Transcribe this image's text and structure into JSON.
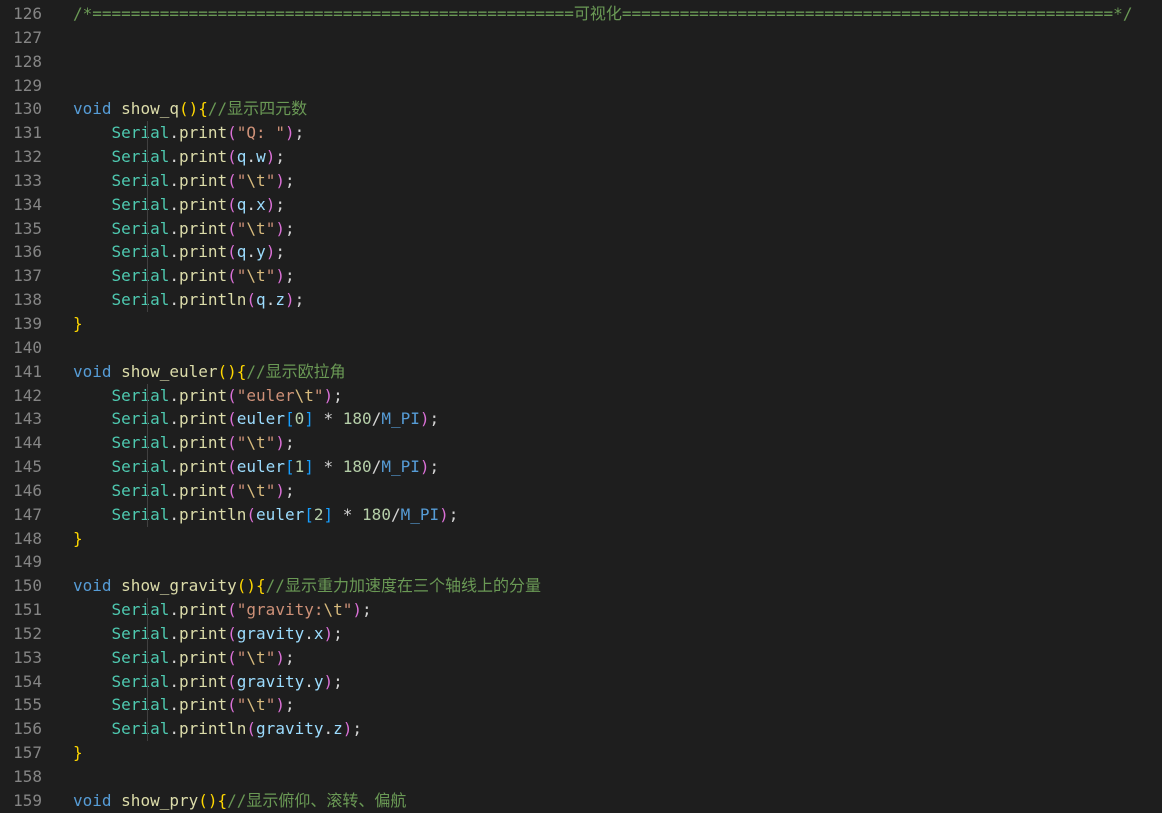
{
  "editor": {
    "language": "cpp",
    "colors": {
      "background": "#1e1e1e",
      "line_number": "#858585",
      "keyword": "#569cd6",
      "function": "#dcdcaa",
      "class": "#4ec9b0",
      "variable": "#9cdcfe",
      "string": "#ce9178",
      "escape": "#d7ba7d",
      "number": "#b5cea8",
      "comment": "#6a9955",
      "bracket_level_1": "#ffd700",
      "bracket_level_2": "#da70d6",
      "bracket_level_3": "#179fff"
    },
    "lines": [
      {
        "num": "126",
        "tokens": [
          [
            "cmt",
            "/*==================================================可视化===================================================*/"
          ]
        ]
      },
      {
        "num": "127",
        "tokens": []
      },
      {
        "num": "128",
        "tokens": []
      },
      {
        "num": "129",
        "tokens": []
      },
      {
        "num": "130",
        "tokens": [
          [
            "kw",
            "void"
          ],
          [
            "op",
            " "
          ],
          [
            "fn",
            "show_q"
          ],
          [
            "b1",
            "()"
          ],
          [
            "b1",
            "{"
          ],
          [
            "cmt",
            "//显示四元数"
          ]
        ]
      },
      {
        "num": "131",
        "guide": true,
        "tokens": [
          [
            "op",
            "    "
          ],
          [
            "obj",
            "Serial"
          ],
          [
            "op",
            "."
          ],
          [
            "fn",
            "print"
          ],
          [
            "b2",
            "("
          ],
          [
            "str",
            "\"Q: \""
          ],
          [
            "b2",
            ")"
          ],
          [
            "op",
            ";"
          ]
        ]
      },
      {
        "num": "132",
        "guide": true,
        "tokens": [
          [
            "op",
            "    "
          ],
          [
            "obj",
            "Serial"
          ],
          [
            "op",
            "."
          ],
          [
            "fn",
            "print"
          ],
          [
            "b2",
            "("
          ],
          [
            "var",
            "q"
          ],
          [
            "op",
            "."
          ],
          [
            "var",
            "w"
          ],
          [
            "b2",
            ")"
          ],
          [
            "op",
            ";"
          ]
        ]
      },
      {
        "num": "133",
        "guide": true,
        "tokens": [
          [
            "op",
            "    "
          ],
          [
            "obj",
            "Serial"
          ],
          [
            "op",
            "."
          ],
          [
            "fn",
            "print"
          ],
          [
            "b2",
            "("
          ],
          [
            "str",
            "\""
          ],
          [
            "esc",
            "\\t"
          ],
          [
            "str",
            "\""
          ],
          [
            "b2",
            ")"
          ],
          [
            "op",
            ";"
          ]
        ]
      },
      {
        "num": "134",
        "guide": true,
        "tokens": [
          [
            "op",
            "    "
          ],
          [
            "obj",
            "Serial"
          ],
          [
            "op",
            "."
          ],
          [
            "fn",
            "print"
          ],
          [
            "b2",
            "("
          ],
          [
            "var",
            "q"
          ],
          [
            "op",
            "."
          ],
          [
            "var",
            "x"
          ],
          [
            "b2",
            ")"
          ],
          [
            "op",
            ";"
          ]
        ]
      },
      {
        "num": "135",
        "guide": true,
        "tokens": [
          [
            "op",
            "    "
          ],
          [
            "obj",
            "Serial"
          ],
          [
            "op",
            "."
          ],
          [
            "fn",
            "print"
          ],
          [
            "b2",
            "("
          ],
          [
            "str",
            "\""
          ],
          [
            "esc",
            "\\t"
          ],
          [
            "str",
            "\""
          ],
          [
            "b2",
            ")"
          ],
          [
            "op",
            ";"
          ]
        ]
      },
      {
        "num": "136",
        "guide": true,
        "tokens": [
          [
            "op",
            "    "
          ],
          [
            "obj",
            "Serial"
          ],
          [
            "op",
            "."
          ],
          [
            "fn",
            "print"
          ],
          [
            "b2",
            "("
          ],
          [
            "var",
            "q"
          ],
          [
            "op",
            "."
          ],
          [
            "var",
            "y"
          ],
          [
            "b2",
            ")"
          ],
          [
            "op",
            ";"
          ]
        ]
      },
      {
        "num": "137",
        "guide": true,
        "tokens": [
          [
            "op",
            "    "
          ],
          [
            "obj",
            "Serial"
          ],
          [
            "op",
            "."
          ],
          [
            "fn",
            "print"
          ],
          [
            "b2",
            "("
          ],
          [
            "str",
            "\""
          ],
          [
            "esc",
            "\\t"
          ],
          [
            "str",
            "\""
          ],
          [
            "b2",
            ")"
          ],
          [
            "op",
            ";"
          ]
        ]
      },
      {
        "num": "138",
        "guide": true,
        "tokens": [
          [
            "op",
            "    "
          ],
          [
            "obj",
            "Serial"
          ],
          [
            "op",
            "."
          ],
          [
            "fn",
            "println"
          ],
          [
            "b2",
            "("
          ],
          [
            "var",
            "q"
          ],
          [
            "op",
            "."
          ],
          [
            "var",
            "z"
          ],
          [
            "b2",
            ")"
          ],
          [
            "op",
            ";"
          ]
        ]
      },
      {
        "num": "139",
        "tokens": [
          [
            "b1",
            "}"
          ]
        ]
      },
      {
        "num": "140",
        "tokens": []
      },
      {
        "num": "141",
        "tokens": [
          [
            "kw",
            "void"
          ],
          [
            "op",
            " "
          ],
          [
            "fn",
            "show_euler"
          ],
          [
            "b1",
            "()"
          ],
          [
            "b1",
            "{"
          ],
          [
            "cmt",
            "//显示欧拉角"
          ]
        ]
      },
      {
        "num": "142",
        "guide": true,
        "tokens": [
          [
            "op",
            "    "
          ],
          [
            "obj",
            "Serial"
          ],
          [
            "op",
            "."
          ],
          [
            "fn",
            "print"
          ],
          [
            "b2",
            "("
          ],
          [
            "str",
            "\"euler"
          ],
          [
            "esc",
            "\\t"
          ],
          [
            "str",
            "\""
          ],
          [
            "b2",
            ")"
          ],
          [
            "op",
            ";"
          ]
        ]
      },
      {
        "num": "143",
        "guide": true,
        "tokens": [
          [
            "op",
            "    "
          ],
          [
            "obj",
            "Serial"
          ],
          [
            "op",
            "."
          ],
          [
            "fn",
            "print"
          ],
          [
            "b2",
            "("
          ],
          [
            "var",
            "euler"
          ],
          [
            "b3",
            "["
          ],
          [
            "num",
            "0"
          ],
          [
            "b3",
            "]"
          ],
          [
            "op",
            " * "
          ],
          [
            "num",
            "180"
          ],
          [
            "op",
            "/"
          ],
          [
            "mac",
            "M_PI"
          ],
          [
            "b2",
            ")"
          ],
          [
            "op",
            ";"
          ]
        ]
      },
      {
        "num": "144",
        "guide": true,
        "tokens": [
          [
            "op",
            "    "
          ],
          [
            "obj",
            "Serial"
          ],
          [
            "op",
            "."
          ],
          [
            "fn",
            "print"
          ],
          [
            "b2",
            "("
          ],
          [
            "str",
            "\""
          ],
          [
            "esc",
            "\\t"
          ],
          [
            "str",
            "\""
          ],
          [
            "b2",
            ")"
          ],
          [
            "op",
            ";"
          ]
        ]
      },
      {
        "num": "145",
        "guide": true,
        "tokens": [
          [
            "op",
            "    "
          ],
          [
            "obj",
            "Serial"
          ],
          [
            "op",
            "."
          ],
          [
            "fn",
            "print"
          ],
          [
            "b2",
            "("
          ],
          [
            "var",
            "euler"
          ],
          [
            "b3",
            "["
          ],
          [
            "num",
            "1"
          ],
          [
            "b3",
            "]"
          ],
          [
            "op",
            " * "
          ],
          [
            "num",
            "180"
          ],
          [
            "op",
            "/"
          ],
          [
            "mac",
            "M_PI"
          ],
          [
            "b2",
            ")"
          ],
          [
            "op",
            ";"
          ]
        ]
      },
      {
        "num": "146",
        "guide": true,
        "tokens": [
          [
            "op",
            "    "
          ],
          [
            "obj",
            "Serial"
          ],
          [
            "op",
            "."
          ],
          [
            "fn",
            "print"
          ],
          [
            "b2",
            "("
          ],
          [
            "str",
            "\""
          ],
          [
            "esc",
            "\\t"
          ],
          [
            "str",
            "\""
          ],
          [
            "b2",
            ")"
          ],
          [
            "op",
            ";"
          ]
        ]
      },
      {
        "num": "147",
        "guide": true,
        "tokens": [
          [
            "op",
            "    "
          ],
          [
            "obj",
            "Serial"
          ],
          [
            "op",
            "."
          ],
          [
            "fn",
            "println"
          ],
          [
            "b2",
            "("
          ],
          [
            "var",
            "euler"
          ],
          [
            "b3",
            "["
          ],
          [
            "num",
            "2"
          ],
          [
            "b3",
            "]"
          ],
          [
            "op",
            " * "
          ],
          [
            "num",
            "180"
          ],
          [
            "op",
            "/"
          ],
          [
            "mac",
            "M_PI"
          ],
          [
            "b2",
            ")"
          ],
          [
            "op",
            ";"
          ]
        ]
      },
      {
        "num": "148",
        "tokens": [
          [
            "b1",
            "}"
          ]
        ]
      },
      {
        "num": "149",
        "tokens": []
      },
      {
        "num": "150",
        "tokens": [
          [
            "kw",
            "void"
          ],
          [
            "op",
            " "
          ],
          [
            "fn",
            "show_gravity"
          ],
          [
            "b1",
            "()"
          ],
          [
            "b1",
            "{"
          ],
          [
            "cmt",
            "//显示重力加速度在三个轴线上的分量"
          ]
        ]
      },
      {
        "num": "151",
        "guide": true,
        "tokens": [
          [
            "op",
            "    "
          ],
          [
            "obj",
            "Serial"
          ],
          [
            "op",
            "."
          ],
          [
            "fn",
            "print"
          ],
          [
            "b2",
            "("
          ],
          [
            "str",
            "\"gravity:"
          ],
          [
            "esc",
            "\\t"
          ],
          [
            "str",
            "\""
          ],
          [
            "b2",
            ")"
          ],
          [
            "op",
            ";"
          ]
        ]
      },
      {
        "num": "152",
        "guide": true,
        "tokens": [
          [
            "op",
            "    "
          ],
          [
            "obj",
            "Serial"
          ],
          [
            "op",
            "."
          ],
          [
            "fn",
            "print"
          ],
          [
            "b2",
            "("
          ],
          [
            "var",
            "gravity"
          ],
          [
            "op",
            "."
          ],
          [
            "var",
            "x"
          ],
          [
            "b2",
            ")"
          ],
          [
            "op",
            ";"
          ]
        ]
      },
      {
        "num": "153",
        "guide": true,
        "tokens": [
          [
            "op",
            "    "
          ],
          [
            "obj",
            "Serial"
          ],
          [
            "op",
            "."
          ],
          [
            "fn",
            "print"
          ],
          [
            "b2",
            "("
          ],
          [
            "str",
            "\""
          ],
          [
            "esc",
            "\\t"
          ],
          [
            "str",
            "\""
          ],
          [
            "b2",
            ")"
          ],
          [
            "op",
            ";"
          ]
        ]
      },
      {
        "num": "154",
        "guide": true,
        "tokens": [
          [
            "op",
            "    "
          ],
          [
            "obj",
            "Serial"
          ],
          [
            "op",
            "."
          ],
          [
            "fn",
            "print"
          ],
          [
            "b2",
            "("
          ],
          [
            "var",
            "gravity"
          ],
          [
            "op",
            "."
          ],
          [
            "var",
            "y"
          ],
          [
            "b2",
            ")"
          ],
          [
            "op",
            ";"
          ]
        ]
      },
      {
        "num": "155",
        "guide": true,
        "tokens": [
          [
            "op",
            "    "
          ],
          [
            "obj",
            "Serial"
          ],
          [
            "op",
            "."
          ],
          [
            "fn",
            "print"
          ],
          [
            "b2",
            "("
          ],
          [
            "str",
            "\""
          ],
          [
            "esc",
            "\\t"
          ],
          [
            "str",
            "\""
          ],
          [
            "b2",
            ")"
          ],
          [
            "op",
            ";"
          ]
        ]
      },
      {
        "num": "156",
        "guide": true,
        "tokens": [
          [
            "op",
            "    "
          ],
          [
            "obj",
            "Serial"
          ],
          [
            "op",
            "."
          ],
          [
            "fn",
            "println"
          ],
          [
            "b2",
            "("
          ],
          [
            "var",
            "gravity"
          ],
          [
            "op",
            "."
          ],
          [
            "var",
            "z"
          ],
          [
            "b2",
            ")"
          ],
          [
            "op",
            ";"
          ]
        ]
      },
      {
        "num": "157",
        "tokens": [
          [
            "b1",
            "}"
          ]
        ]
      },
      {
        "num": "158",
        "tokens": []
      },
      {
        "num": "159",
        "tokens": [
          [
            "kw",
            "void"
          ],
          [
            "op",
            " "
          ],
          [
            "fn",
            "show_pry"
          ],
          [
            "b1",
            "()"
          ],
          [
            "b1",
            "{"
          ],
          [
            "cmt",
            "//显示俯仰、滚转、偏航"
          ]
        ]
      }
    ]
  }
}
